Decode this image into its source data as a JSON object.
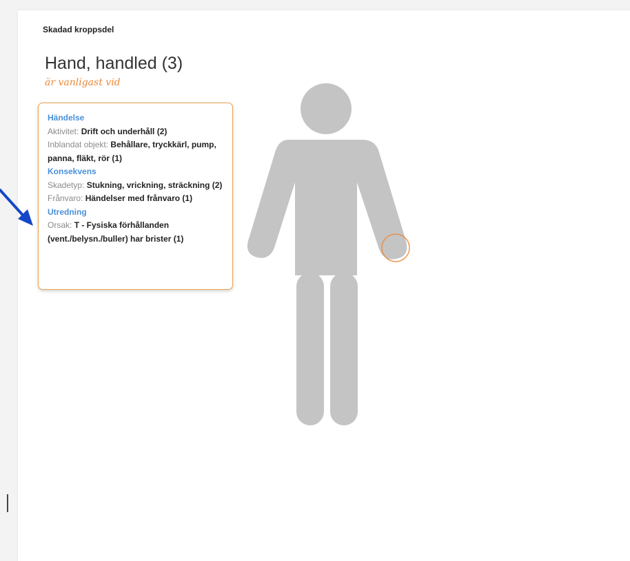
{
  "section_label": "Skadad kroppsdel",
  "body_part": {
    "title": "Hand, handled",
    "count": "(3)",
    "subtitle": "är vanligast vid"
  },
  "info_card": {
    "handelse": {
      "heading": "Händelse",
      "aktivitet_key": "Aktivitet:",
      "aktivitet_val": "Drift och underhåll (2)",
      "objekt_key": "Inblandat objekt:",
      "objekt_val": "Behållare, tryckkärl, pump, panna, fläkt, rör (1)"
    },
    "konsekvens": {
      "heading": "Konsekvens",
      "skadetyp_key": "Skadetyp:",
      "skadetyp_val": "Stukning, vrickning, sträckning (2)",
      "franvaro_key": "Frånvaro:",
      "franvaro_val": "Händelser med frånvaro (1)"
    },
    "utredning": {
      "heading": "Utredning",
      "orsak_key": "Orsak:",
      "orsak_val": "T - Fysiska förhållanden (vent./belysn./buller) har brister (1)"
    }
  },
  "colors": {
    "figure": "#c4c4c4",
    "accent_orange": "#e9893a",
    "heading_blue": "#4a90d9",
    "arrow_blue": "#1447c8"
  }
}
